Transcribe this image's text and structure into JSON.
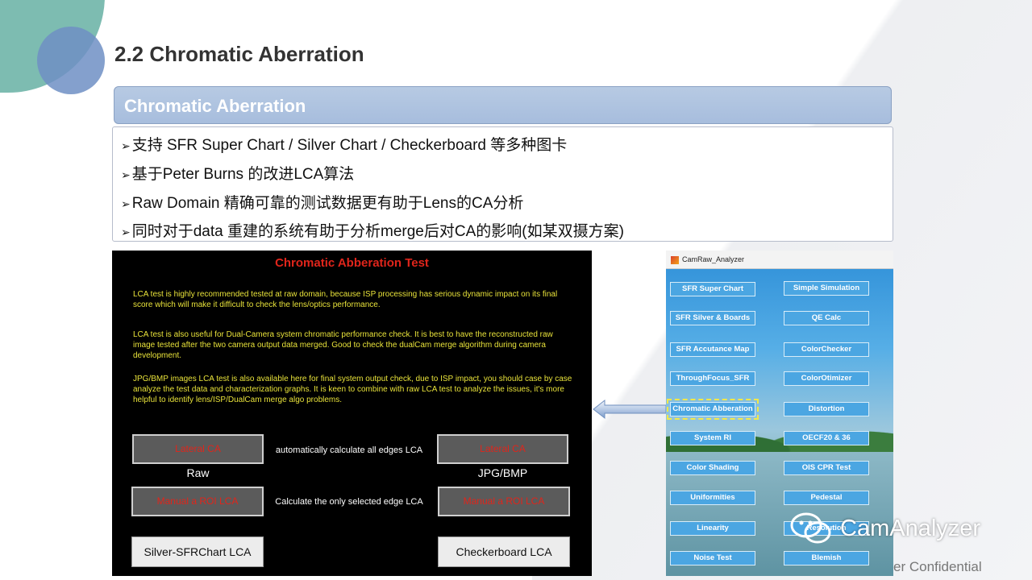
{
  "slide": {
    "title": "2.2  Chromatic Aberration",
    "section_header": "Chromatic Aberration",
    "bullets": [
      "支持 SFR Super Chart / Silver Chart / Checkerboard 等多种图卡",
      "基于Peter Burns 的改进LCA算法",
      "Raw Domain 精确可靠的测试数据更有助于Lens的CA分析",
      "同时对于data 重建的系统有助于分析merge后对CA的影响(如某双摄方案)"
    ],
    "bullet_marker": "➢",
    "footer": "er Confidential",
    "watermark": "CamAnalyzer"
  },
  "panel": {
    "title": "Chromatic Abberation Test",
    "paragraphs": [
      "LCA test is highly recommended tested at raw domain, because ISP processing has serious dynamic impact on its final score which will make it difficult to check the lens/optics performance.",
      "LCA test is also useful for Dual-Camera system chromatic performance check. It is best to have the reconstructed raw image tested after the two camera output data merged. Good to check the dualCam merge algorithm during camera development.",
      "JPG/BMP images LCA test is also available here for final system output check, due to ISP impact, you should case by case analyze the test data and characterization graphs.  It is keen to combine with raw LCA test to analyze the issues, it's more helpful to identify lens/ISP/DualCam merge algo problems."
    ],
    "buttons": {
      "lateral_ca_raw": "Lateral CA",
      "lateral_ca_jpg": "Lateral CA",
      "manual_roi_raw": "Manual a ROI LCA",
      "manual_roi_jpg": "Manual a ROI LCA",
      "silver": "Silver-SFRChart LCA",
      "checkerboard": "Checkerboard LCA"
    },
    "captions": {
      "raw": "Raw",
      "jpg": "JPG/BMP",
      "auto": "automatically calculate all edges LCA",
      "selected": "Calculate the only selected edge LCA"
    }
  },
  "app": {
    "title": "CamRaw_Analyzer",
    "left_buttons": [
      "SFR Super Chart",
      "SFR Silver & Boards",
      "SFR Accutance Map",
      "ThroughFocus_SFR",
      "Chromatic Abberation",
      "System RI",
      "Color Shading",
      "Uniformities",
      "Linearity",
      "Noise Test"
    ],
    "right_buttons": [
      "Simple Simulation",
      "QE Calc",
      "ColorChecker",
      "ColorOtimizer",
      "Distortion",
      "OECF20 & 36",
      "OIS CPR Test",
      "Pedestal",
      "Resolution",
      "Blemish"
    ],
    "selected_button": "Chromatic Abberation"
  },
  "colors": {
    "accent_teal": "#6fb5a9",
    "accent_blue": "#6f8fc4",
    "panel_title_red": "#e0251b",
    "panel_text_yellow": "#e8e23a",
    "app_button_blue": "#4ba6e2"
  }
}
